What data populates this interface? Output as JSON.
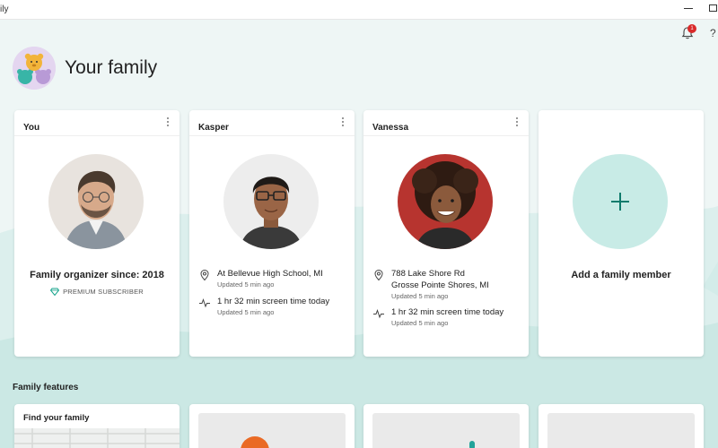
{
  "window": {
    "title": "ily"
  },
  "notifications": {
    "count": "1"
  },
  "help_label": "?",
  "header": {
    "title": "Your family"
  },
  "members": [
    {
      "name": "You",
      "organizer_text": "Family organizer since: 2018",
      "subscription": "PREMIUM SUBSCRIBER"
    },
    {
      "name": "Kasper",
      "location": "At Bellevue High School, MI",
      "location_updated": "Updated 5 min ago",
      "screen_time": "1 hr 32 min screen time today",
      "screen_time_updated": "Updated 5 min ago"
    },
    {
      "name": "Vanessa",
      "location_line1": "788 Lake Shore Rd",
      "location_line2": "Grosse Pointe Shores, MI",
      "location_updated": "Updated 5 min ago",
      "screen_time": "1 hr 32 min screen time today",
      "screen_time_updated": "Updated 5 min ago"
    }
  ],
  "add_member": {
    "label": "Add a family member"
  },
  "features": {
    "title": "Family features",
    "find_family": "Find your family"
  },
  "colors": {
    "accent": "#0f7b6c",
    "add_circle": "#c8ebe6",
    "background": "#eef6f5",
    "badge": "#d92a2a"
  }
}
